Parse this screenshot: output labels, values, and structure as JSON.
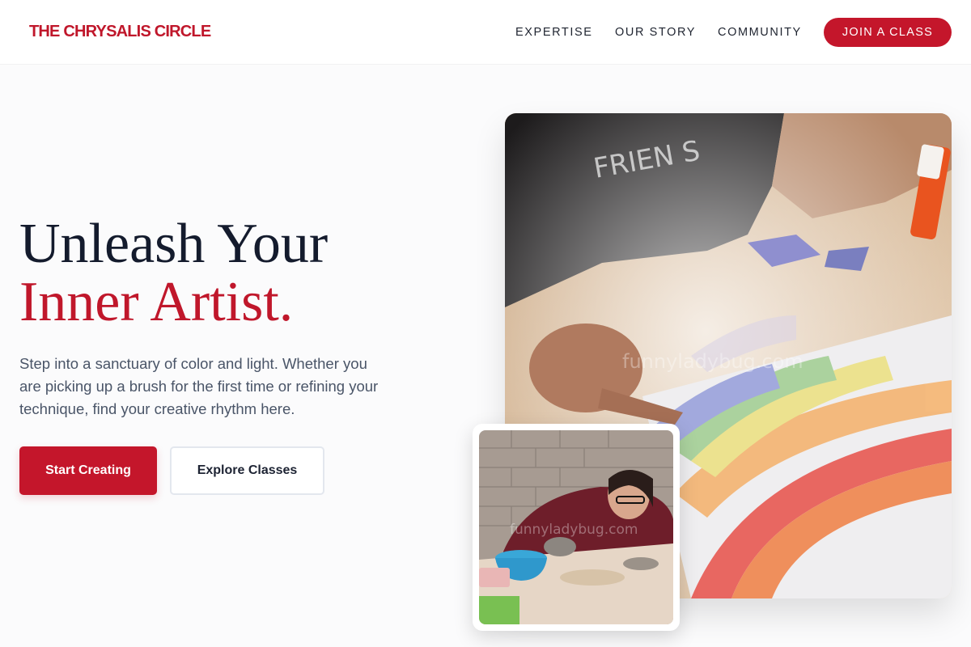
{
  "header": {
    "brand": "THE CHRYSALIS CIRCLE",
    "nav": [
      "EXPERTISE",
      "OUR STORY",
      "COMMUNITY"
    ],
    "cta": "JOIN A CLASS"
  },
  "hero": {
    "title_line1": "Unleash Your",
    "title_line2": "Inner Artist.",
    "description": "Step into a sanctuary of color and light. Whether you are picking up a brush for the first time or refining your technique, find your creative rhythm here.",
    "primary_button": "Start Creating",
    "secondary_button": "Explore Classes"
  },
  "images": {
    "main_watermark": "funnyladybug.com",
    "small_watermark": "funnyladybug.com"
  },
  "colors": {
    "accent": "#c4162b",
    "heading": "#141b2d",
    "body_text": "#4a5568"
  }
}
